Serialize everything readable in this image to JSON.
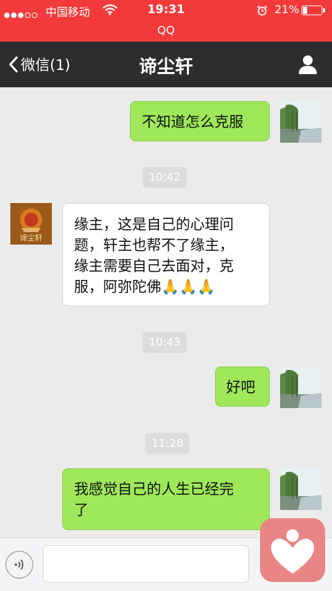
{
  "status_bar": {
    "carrier": "中国移动",
    "time": "19:31",
    "battery_text": "21%",
    "battery_level": 0.21,
    "signal_filled": 3,
    "signal_total": 5,
    "app_label": "QQ",
    "background_color": "#f23a3a"
  },
  "nav": {
    "back_label": "微信(1)",
    "title": "谛尘轩",
    "profile_icon": "person-icon"
  },
  "avatars": {
    "them_logo_text": "谛尘轩"
  },
  "messages": [
    {
      "type": "message",
      "sender": "me",
      "lines": [
        "不知道怎么克服"
      ]
    },
    {
      "type": "timestamp",
      "text": "10:42"
    },
    {
      "type": "message",
      "sender": "them",
      "lines": [
        "缘主，这是自己的心理问",
        "题，轩主也帮不了缘主，",
        "缘主需要自己去面对，克",
        "服，阿弥陀佛🙏🙏🙏"
      ]
    },
    {
      "type": "timestamp",
      "text": "10:43"
    },
    {
      "type": "message",
      "sender": "me",
      "lines": [
        "好吧"
      ]
    },
    {
      "type": "timestamp",
      "text": "11:28"
    },
    {
      "type": "message",
      "sender": "me",
      "lines": [
        "我感觉自己的人生已经完",
        "了"
      ]
    }
  ],
  "input_bar": {
    "voice_icon": "voice-icon",
    "input_value": "",
    "input_placeholder": ""
  },
  "floating_button": {
    "icon": "heart-person-icon",
    "color": "#ea8585"
  },
  "colors": {
    "my_bubble": "#9fe85a",
    "their_bubble": "#ffffff",
    "nav_bar": "#2d2d2f"
  }
}
